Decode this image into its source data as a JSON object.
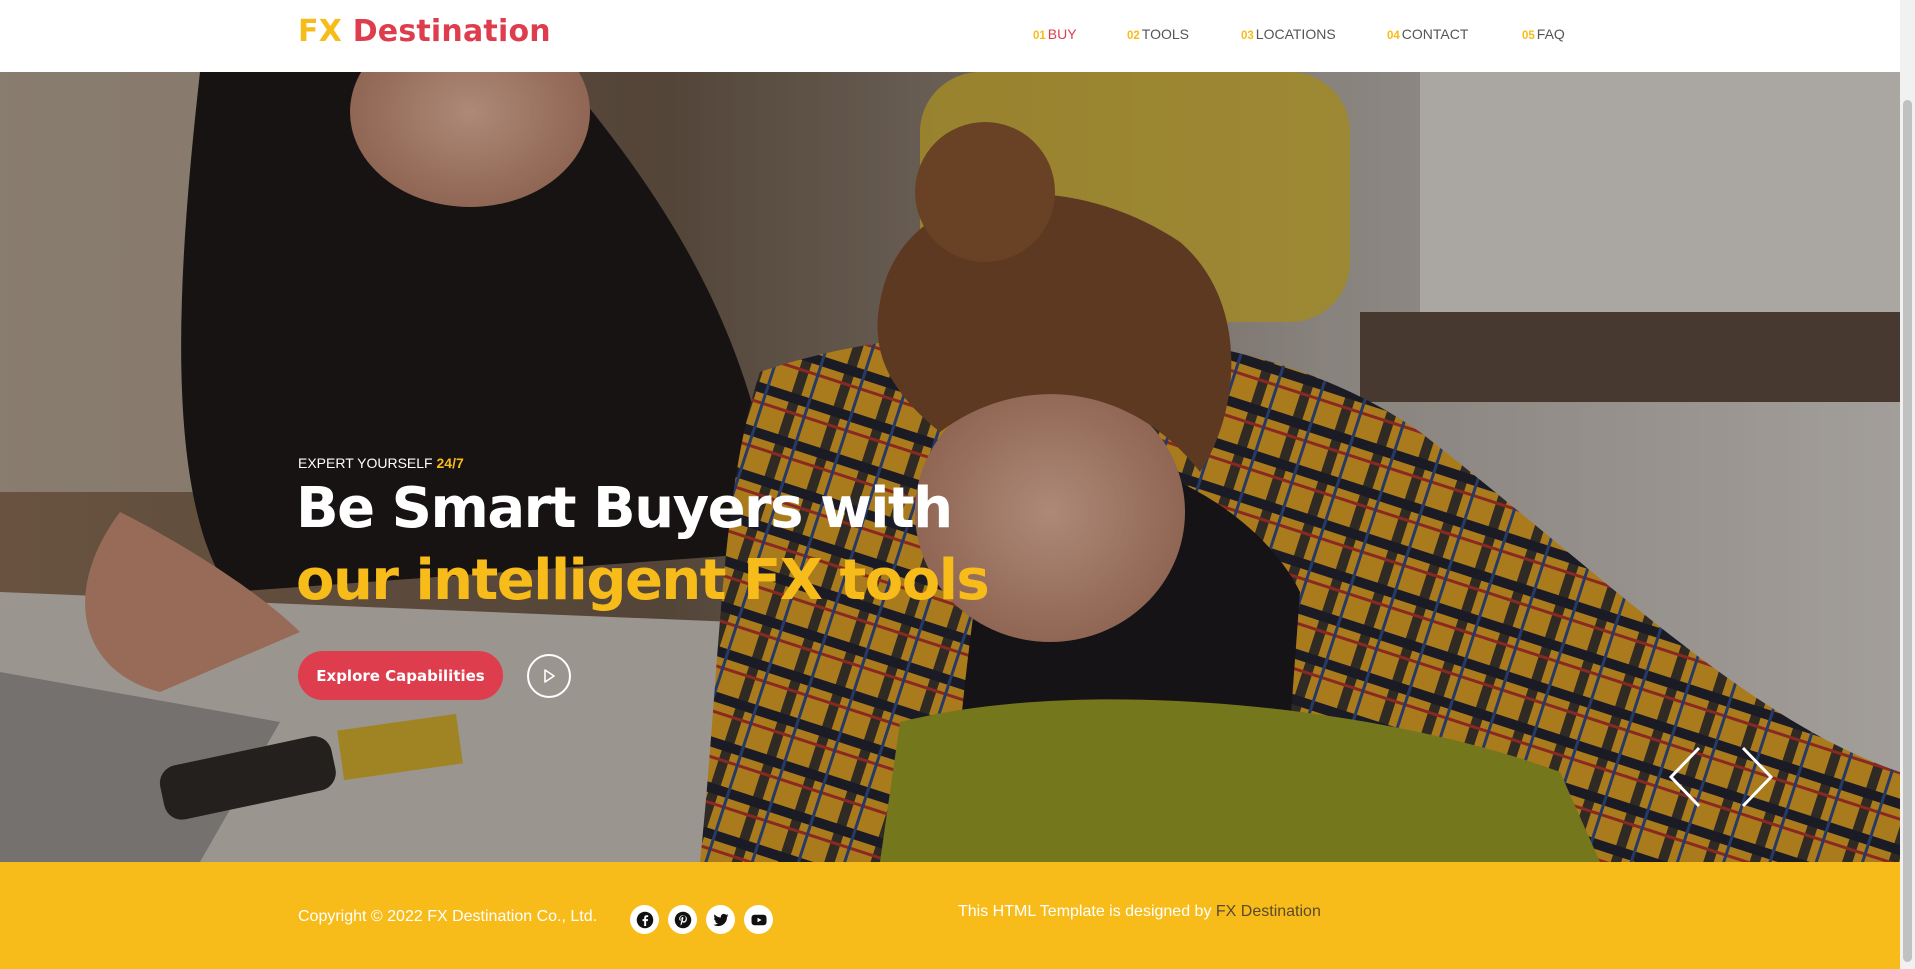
{
  "brand": {
    "part1": "FX",
    "part2": "Destination"
  },
  "nav": [
    {
      "num": "01",
      "label": "BUY",
      "active": true
    },
    {
      "num": "02",
      "label": "TOOLS"
    },
    {
      "num": "03",
      "label": "LOCATIONS"
    },
    {
      "num": "04",
      "label": "CONTACT"
    },
    {
      "num": "05",
      "label": "FAQ"
    }
  ],
  "hero": {
    "eyebrow_text": "EXPERT YOURSELF",
    "eyebrow_highlight": "24/7",
    "headline_line1": "Be Smart Buyers with",
    "headline_line2": "our intelligent FX tools",
    "cta_label": "Explore Capabilities",
    "play_icon": "play-icon",
    "prev_icon": "chevron-left-icon",
    "next_icon": "chevron-right-icon"
  },
  "footer": {
    "copyright": "Copyright © 2022 FX Destination Co., Ltd.",
    "socials": [
      "facebook-icon",
      "pinterest-icon",
      "twitter-icon",
      "youtube-icon"
    ],
    "credit_text": "This HTML Template is designed by",
    "credit_link": "FX Destination"
  },
  "colors": {
    "accent_yellow": "#f8bc1a",
    "accent_red": "#de3d4e"
  }
}
